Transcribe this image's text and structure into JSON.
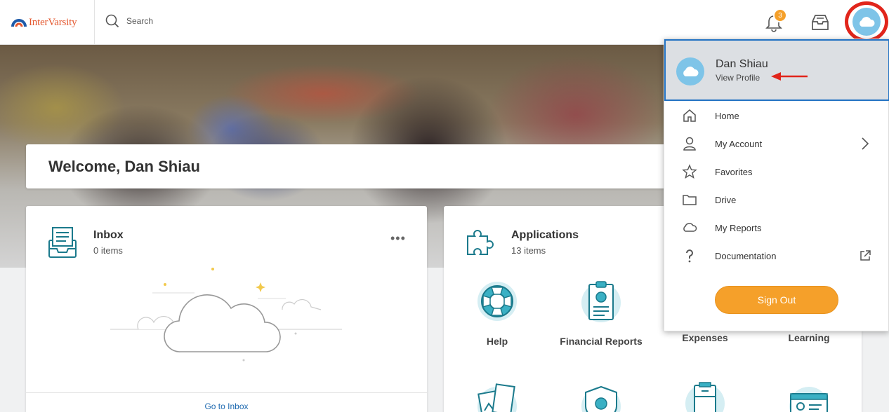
{
  "header": {
    "logo_text": "InterVarsity",
    "search_placeholder": "Search",
    "notification_count": "3",
    "icons": [
      "search-icon",
      "bell-icon",
      "inbox-icon",
      "avatar-cloud-icon"
    ]
  },
  "welcome": {
    "title": "Welcome, Dan Shiau"
  },
  "inbox_card": {
    "title": "Inbox",
    "subtitle": "0 items",
    "more_label": "•••",
    "footer_link": "Go to Inbox"
  },
  "apps_card": {
    "title": "Applications",
    "subtitle": "13 items",
    "apps": [
      {
        "label": "Help",
        "icon": "lifebuoy-icon"
      },
      {
        "label": "Financial Reports",
        "icon": "clipboard-chart-icon"
      },
      {
        "label": "Expenses",
        "icon": "expenses-icon"
      },
      {
        "label": "Learning",
        "icon": "learning-icon"
      }
    ]
  },
  "profile_menu": {
    "user_name": "Dan Shiau",
    "view_profile": "View Profile",
    "items": [
      {
        "label": "Home",
        "icon": "home-icon"
      },
      {
        "label": "My Account",
        "icon": "person-icon",
        "has_submenu": true
      },
      {
        "label": "Favorites",
        "icon": "star-icon"
      },
      {
        "label": "Drive",
        "icon": "folder-icon"
      },
      {
        "label": "My Reports",
        "icon": "cloud-icon"
      },
      {
        "label": "Documentation",
        "icon": "question-icon",
        "external": true
      }
    ],
    "sign_out": "Sign Out"
  },
  "colors": {
    "accent_orange": "#f5a02a",
    "highlight_red": "#e1251b",
    "link_blue": "#1f6ab0",
    "avatar_blue": "#7ec4e8",
    "icon_teal": "#1b7a8c"
  }
}
